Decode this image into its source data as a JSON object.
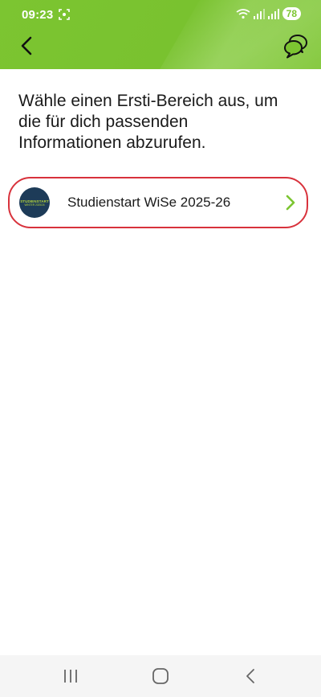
{
  "status_bar": {
    "time": "09:23",
    "battery": "78",
    "icons": [
      "screenshot-icon",
      "wifi-icon",
      "signal-icon",
      "signal-icon",
      "battery-icon"
    ]
  },
  "app_bar": {
    "back_icon": "chevron-left-icon",
    "chat_icon": "chat-bubbles-icon"
  },
  "main": {
    "intro_text": "Wähle einen Ersti-Bereich aus, um die für dich passenden Informationen abzurufen.",
    "items": [
      {
        "label": "Studienstart WiSe 2025-26",
        "logo_text_1": "STUDIENSTART",
        "logo_text_2": "WINTER 2025/26",
        "chevron": "chevron-right-icon"
      }
    ]
  },
  "nav_bar": {
    "buttons": [
      "recent-apps-icon",
      "home-icon",
      "back-icon"
    ]
  },
  "colors": {
    "header_green": "#7cc531",
    "highlight_red": "#d8323c",
    "chevron_green": "#7cc531",
    "logo_navy": "#1d3b58"
  }
}
